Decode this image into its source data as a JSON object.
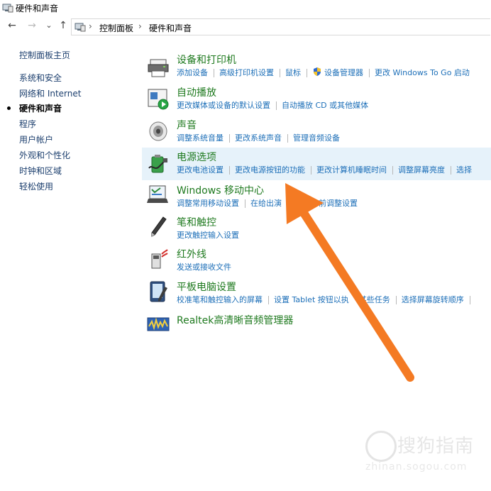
{
  "window": {
    "title": "硬件和声音"
  },
  "nav": {
    "back": "←",
    "forward": "→",
    "recent": "⌄",
    "up": "↑"
  },
  "address": {
    "sep": "›",
    "crumbs": [
      "控制面板",
      "硬件和声音"
    ]
  },
  "leftnav": {
    "items": [
      {
        "label": "控制面板主页"
      },
      {
        "label": "系统和安全"
      },
      {
        "label": "网络和 Internet"
      },
      {
        "label": "硬件和声音",
        "current": true
      },
      {
        "label": "程序"
      },
      {
        "label": "用户帐户"
      },
      {
        "label": "外观和个性化"
      },
      {
        "label": "时钟和区域"
      },
      {
        "label": "轻松使用"
      }
    ]
  },
  "categories": [
    {
      "title": "设备和打印机",
      "icon": "printer-icon",
      "links": [
        "添加设备",
        "高级打印机设置",
        "鼠标",
        "设备管理器",
        "更改 Windows To Go 启动"
      ]
    },
    {
      "title": "自动播放",
      "icon": "autoplay-icon",
      "links": [
        "更改媒体或设备的默认设置",
        "自动播放 CD 或其他媒体"
      ]
    },
    {
      "title": "声音",
      "icon": "speaker-icon",
      "links": [
        "调整系统音量",
        "更改系统声音",
        "管理音频设备"
      ]
    },
    {
      "title": "电源选项",
      "icon": "battery-icon",
      "links": [
        "更改电池设置",
        "更改电源按钮的功能",
        "更改计算机睡眠时间",
        "调整屏幕亮度",
        "选择"
      ]
    },
    {
      "title": "Windows 移动中心",
      "icon": "mobility-center-icon",
      "links": [
        "调整常用移动设置",
        "在给出演",
        "前调整设置"
      ]
    },
    {
      "title": "笔和触控",
      "icon": "pen-icon",
      "links": [
        "更改触控输入设置"
      ]
    },
    {
      "title": "红外线",
      "icon": "infrared-icon",
      "links": [
        "发送或接收文件"
      ]
    },
    {
      "title": "平板电脑设置",
      "icon": "tablet-icon",
      "links": [
        "校准笔和触控输入的屏幕",
        "设置 Tablet 按钮以执",
        "某些任务",
        "选择屏幕旋转顺序"
      ]
    },
    {
      "title": "Realtek高清晰音频管理器",
      "icon": "realtek-audio-icon",
      "links": []
    }
  ],
  "watermark": {
    "text": "搜狗指南",
    "url": "zhinan.sogou.com"
  },
  "colors": {
    "title_green": "#1f7a1f",
    "link_blue": "#1d6fb8",
    "highlight": "#e6f2fa",
    "arrow": "#f47a23"
  }
}
